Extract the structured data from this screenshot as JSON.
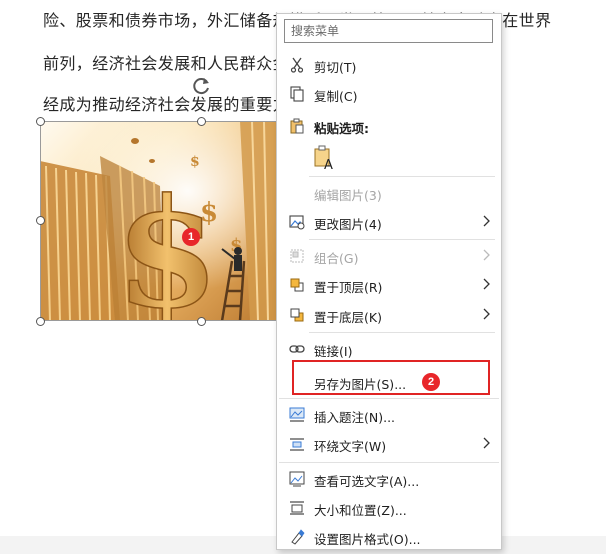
{
  "document": {
    "line1": "险、股票和债券市场，外汇储备规模跃居世界第一，普惠金融走在世界",
    "line2": "前列，经济社会发展和人民群众金融需求得到更好满足，金融已",
    "line3": "经成为推动经济社会发展的重要力量。"
  },
  "callouts": {
    "badge1": "1",
    "badge2": "2"
  },
  "menu": {
    "search_placeholder": "搜索菜单",
    "cut": "剪切(T)",
    "copy": "复制(C)",
    "paste_options": "粘贴选项:",
    "edit_picture": "编辑图片(3)",
    "change_picture": "更改图片(4)",
    "group": "组合(G)",
    "bring_to_front": "置于顶层(R)",
    "send_to_back": "置于底层(K)",
    "link": "链接(I)",
    "save_as_picture": "另存为图片(S)...",
    "insert_caption": "插入题注(N)...",
    "wrap_text": "环绕文字(W)",
    "view_alt_text": "查看可选文字(A)...",
    "size_and_position": "大小和位置(Z)...",
    "format_picture": "设置图片格式(O)..."
  },
  "colors": {
    "highlight": "#e02424",
    "badge": "#e8262a",
    "accent": "#d8a24a"
  }
}
